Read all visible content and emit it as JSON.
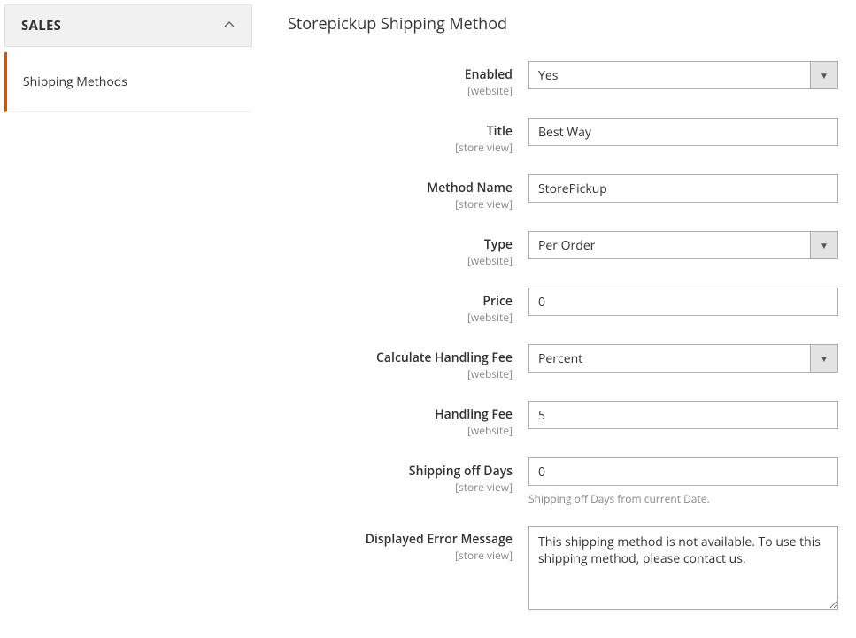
{
  "sidebar": {
    "category": "SALES",
    "active_item": "Shipping Methods"
  },
  "section": {
    "title": "Storepickup Shipping Method"
  },
  "fields": {
    "enabled": {
      "label": "Enabled",
      "scope": "[website]",
      "value": "Yes"
    },
    "title": {
      "label": "Title",
      "scope": "[store view]",
      "value": "Best Way"
    },
    "method_name": {
      "label": "Method Name",
      "scope": "[store view]",
      "value": "StorePickup"
    },
    "type": {
      "label": "Type",
      "scope": "[website]",
      "value": "Per Order"
    },
    "price": {
      "label": "Price",
      "scope": "[website]",
      "value": "0"
    },
    "handling_fee_calc": {
      "label": "Calculate Handling Fee",
      "scope": "[website]",
      "value": "Percent"
    },
    "handling_fee": {
      "label": "Handling Fee",
      "scope": "[website]",
      "value": "5"
    },
    "shipping_off_days": {
      "label": "Shipping off Days",
      "scope": "[store view]",
      "value": "0",
      "help": "Shipping off Days from current Date."
    },
    "error_message": {
      "label": "Displayed Error Message",
      "scope": "[store view]",
      "value": "This shipping method is not available. To use this shipping method, please contact us."
    }
  }
}
